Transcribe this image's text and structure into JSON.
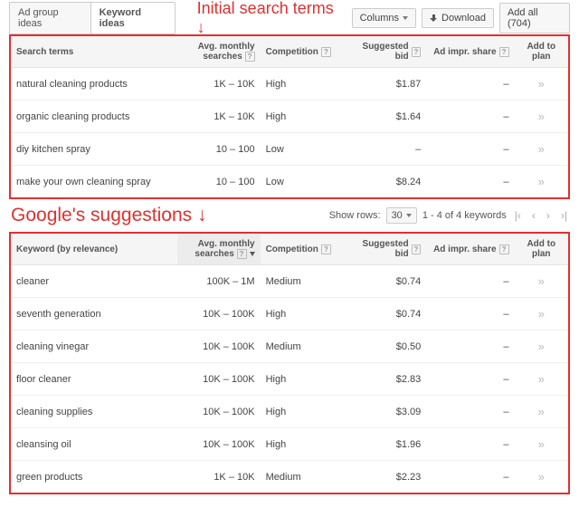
{
  "tabs": {
    "ad_group": "Ad group ideas",
    "keyword": "Keyword ideas"
  },
  "toolbar": {
    "columns": "Columns",
    "download": "Download",
    "add_all": "Add all (704)"
  },
  "annotation1": "Initial search terms ↓",
  "annotation2": "Google's suggestions ↓",
  "columns": {
    "search_terms": "Search terms",
    "keyword": "Keyword (by relevance)",
    "volume_l1": "Avg. monthly",
    "volume_l2": "searches",
    "competition": "Competition",
    "bid": "Suggested bid",
    "share": "Ad impr. share",
    "add": "Add to plan"
  },
  "initial_rows": [
    {
      "term": "natural cleaning products",
      "vol": "1K – 10K",
      "comp": "High",
      "bid": "$1.87",
      "share": "–"
    },
    {
      "term": "organic cleaning products",
      "vol": "1K – 10K",
      "comp": "High",
      "bid": "$1.64",
      "share": "–"
    },
    {
      "term": "diy kitchen spray",
      "vol": "10 – 100",
      "comp": "Low",
      "bid": "–",
      "share": "–"
    },
    {
      "term": "make your own cleaning spray",
      "vol": "10 – 100",
      "comp": "Low",
      "bid": "$8.24",
      "share": "–"
    }
  ],
  "pager": {
    "show_rows": "Show rows:",
    "value": "30",
    "range": "1 - 4 of 4 keywords"
  },
  "suggestion_rows": [
    {
      "term": "cleaner",
      "vol": "100K – 1M",
      "comp": "Medium",
      "bid": "$0.74",
      "share": "–"
    },
    {
      "term": "seventh generation",
      "vol": "10K – 100K",
      "comp": "High",
      "bid": "$0.74",
      "share": "–"
    },
    {
      "term": "cleaning vinegar",
      "vol": "10K – 100K",
      "comp": "Medium",
      "bid": "$0.50",
      "share": "–"
    },
    {
      "term": "floor cleaner",
      "vol": "10K – 100K",
      "comp": "High",
      "bid": "$2.83",
      "share": "–"
    },
    {
      "term": "cleaning supplies",
      "vol": "10K – 100K",
      "comp": "High",
      "bid": "$3.09",
      "share": "–"
    },
    {
      "term": "cleansing oil",
      "vol": "10K – 100K",
      "comp": "High",
      "bid": "$1.96",
      "share": "–"
    },
    {
      "term": "green products",
      "vol": "1K – 10K",
      "comp": "Medium",
      "bid": "$2.23",
      "share": "–"
    }
  ]
}
